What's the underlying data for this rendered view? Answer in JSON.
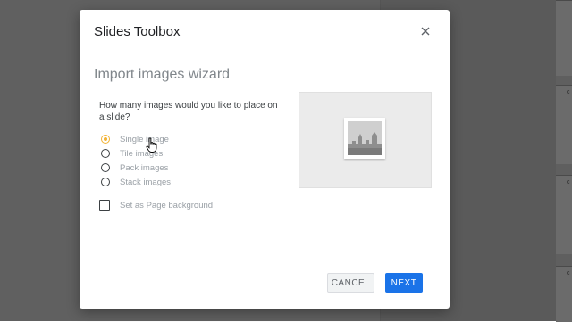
{
  "dialog": {
    "title": "Slides Toolbox",
    "close_icon": "close-icon"
  },
  "wizard": {
    "title": "Import images wizard",
    "question": "How many images would you like to place on a slide?",
    "options": [
      {
        "label": "Single image",
        "selected": true
      },
      {
        "label": "Tile images",
        "selected": false
      },
      {
        "label": "Pack images",
        "selected": false
      },
      {
        "label": "Stack images",
        "selected": false
      }
    ],
    "checkbox": {
      "label": "Set as Page background",
      "checked": false
    },
    "preview_icon": "image-placeholder-icon"
  },
  "buttons": {
    "cancel": "CANCEL",
    "next": "NEXT"
  },
  "colors": {
    "accent": "#1a73e8",
    "radio_selected": "#f2b233"
  }
}
